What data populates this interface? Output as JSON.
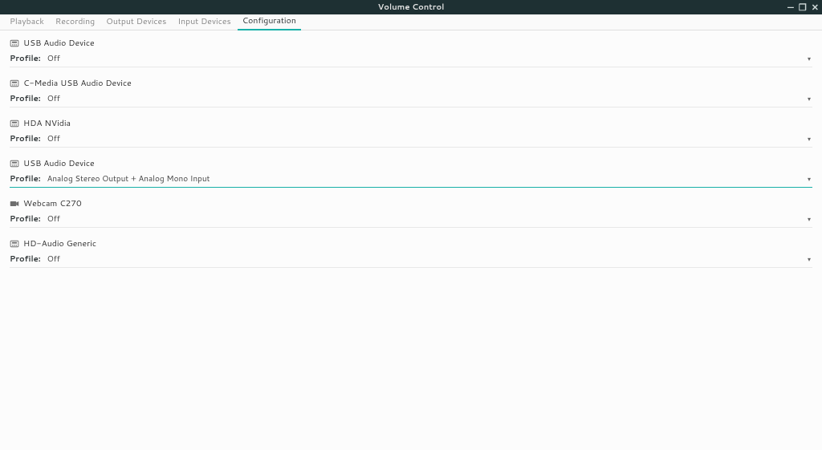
{
  "window": {
    "title": "Volume Control"
  },
  "tabs": {
    "playback": "Playback",
    "recording": "Recording",
    "output": "Output Devices",
    "input": "Input Devices",
    "configuration": "Configuration",
    "active": "configuration"
  },
  "devices": [
    {
      "icon": "card",
      "name": "USB Audio Device",
      "profile_label": "Profile:",
      "profile_value": "Off",
      "highlight": false
    },
    {
      "icon": "card",
      "name": "C-Media USB Audio Device",
      "profile_label": "Profile:",
      "profile_value": "Off",
      "highlight": false
    },
    {
      "icon": "card",
      "name": "HDA NVidia",
      "profile_label": "Profile:",
      "profile_value": "Off",
      "highlight": false
    },
    {
      "icon": "card",
      "name": "USB Audio Device",
      "profile_label": "Profile:",
      "profile_value": "Analog Stereo Output + Analog Mono Input",
      "highlight": true
    },
    {
      "icon": "camera",
      "name": "Webcam C270",
      "profile_label": "Profile:",
      "profile_value": "Off",
      "highlight": false
    },
    {
      "icon": "card",
      "name": "HD-Audio Generic",
      "profile_label": "Profile:",
      "profile_value": "Off",
      "highlight": false
    }
  ]
}
